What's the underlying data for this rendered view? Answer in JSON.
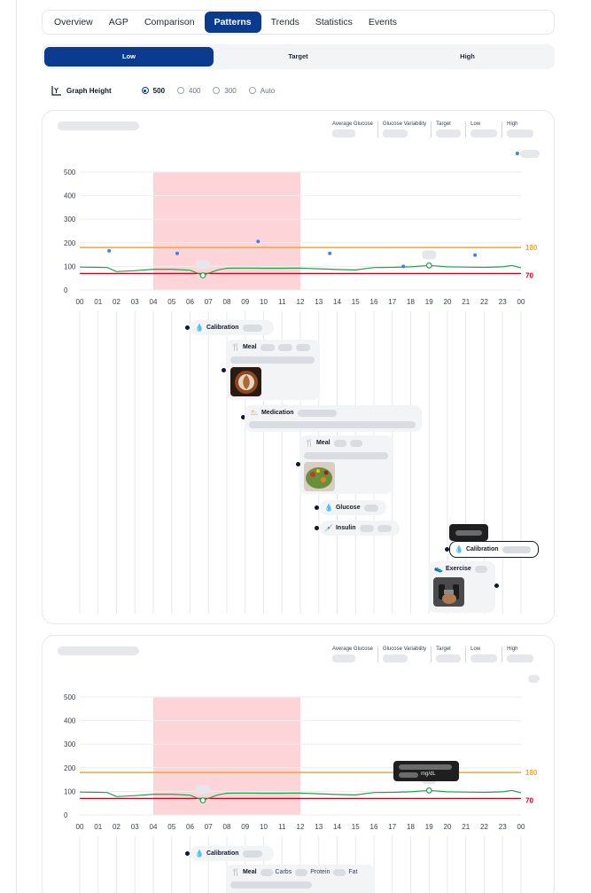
{
  "tabs": [
    "Overview",
    "AGP",
    "Comparison",
    "Patterns",
    "Trends",
    "Statistics",
    "Events"
  ],
  "active_tab": "Patterns",
  "segments": {
    "low": "Low",
    "target": "Target",
    "high": "High"
  },
  "graph_height": {
    "label": "Graph Height",
    "options": [
      "500",
      "400",
      "300",
      "Auto"
    ],
    "selected": "500"
  },
  "stats_labels": {
    "average_glucose": "Average Glucose",
    "glucose_variability": "Glucose Variability",
    "target": "Target",
    "low": "Low",
    "high": "High"
  },
  "chart": {
    "y_ticks": [
      "500",
      "400",
      "300",
      "200",
      "100",
      "0"
    ],
    "x_ticks": [
      "00",
      "01",
      "02",
      "03",
      "04",
      "05",
      "06",
      "07",
      "08",
      "09",
      "10",
      "11",
      "12",
      "13",
      "14",
      "15",
      "16",
      "17",
      "18",
      "19",
      "20",
      "21",
      "22",
      "23",
      "00"
    ],
    "high_threshold_label": "180",
    "low_threshold_label": "70",
    "colors": {
      "high": "#f5a623",
      "low": "#d0021b",
      "glucose": "#22a34a",
      "band": "#fdd5d8",
      "points": "#3b82f6"
    }
  },
  "chart_data": [
    {
      "type": "line",
      "title": "",
      "xlabel": "",
      "ylabel": "",
      "xlim": [
        0,
        24
      ],
      "ylim": [
        0,
        500
      ],
      "grid": true,
      "shaded_range_x": [
        4,
        12
      ],
      "thresholds": [
        {
          "label": "180",
          "value": 180
        },
        {
          "label": "70",
          "value": 70
        }
      ],
      "series": [
        {
          "values_x": [
            0,
            1,
            1.5,
            2,
            3,
            4,
            5,
            6,
            6.7,
            7.5,
            8,
            9,
            10,
            11,
            12,
            13,
            14,
            15,
            16,
            17,
            18,
            19,
            20,
            21,
            22,
            23,
            23.5,
            24
          ],
          "values_y": [
            97,
            96,
            95,
            78,
            82,
            88,
            88,
            84,
            62,
            85,
            92,
            93,
            92,
            92,
            93,
            90,
            87,
            85,
            95,
            96,
            98,
            104,
            98,
            97,
            96,
            98,
            104,
            94
          ]
        }
      ],
      "points": [
        {
          "x": 1.6,
          "y": 166
        },
        {
          "x": 5.3,
          "y": 155
        },
        {
          "x": 9.7,
          "y": 206
        },
        {
          "x": 13.6,
          "y": 155
        },
        {
          "x": 17.6,
          "y": 100
        },
        {
          "x": 21.5,
          "y": 148
        },
        {
          "x": 23.8,
          "y": 578
        }
      ]
    },
    {
      "type": "line",
      "title": "",
      "xlabel": "",
      "ylabel": "",
      "xlim": [
        0,
        24
      ],
      "ylim": [
        0,
        500
      ],
      "grid": true,
      "shaded_range_x": [
        4,
        12
      ],
      "thresholds": [
        {
          "label": "180",
          "value": 180
        },
        {
          "label": "70",
          "value": 70
        }
      ],
      "series": [
        {
          "values_x": [
            0,
            1,
            1.5,
            2,
            3,
            4,
            5,
            6,
            6.7,
            7.5,
            8,
            9,
            10,
            11,
            12,
            13,
            14,
            15,
            16,
            17,
            18,
            19,
            20,
            21,
            22,
            23,
            23.5,
            24
          ],
          "values_y": [
            97,
            96,
            95,
            78,
            82,
            88,
            88,
            84,
            62,
            85,
            92,
            93,
            92,
            92,
            93,
            90,
            87,
            85,
            95,
            96,
            98,
            104,
            98,
            97,
            96,
            98,
            104,
            94
          ]
        }
      ],
      "tooltip_unit": "mg/dL"
    }
  ],
  "events": {
    "calibration": "Calibration",
    "meal": "Meal",
    "medication": "Medication",
    "glucose": "Glucose",
    "insulin": "Insulin",
    "exercise": "Exercise",
    "carbs": "Carbs",
    "protein": "Protein",
    "fat": "Fat"
  },
  "icons": {
    "graph_height": "axis-chart-icon",
    "calibration": "droplet-hand-icon",
    "meal": "fork-knife-icon",
    "medication": "pill-cloud-icon",
    "glucose": "blood-drop-icon",
    "insulin": "syringe-icon",
    "exercise": "sneaker-icon"
  }
}
